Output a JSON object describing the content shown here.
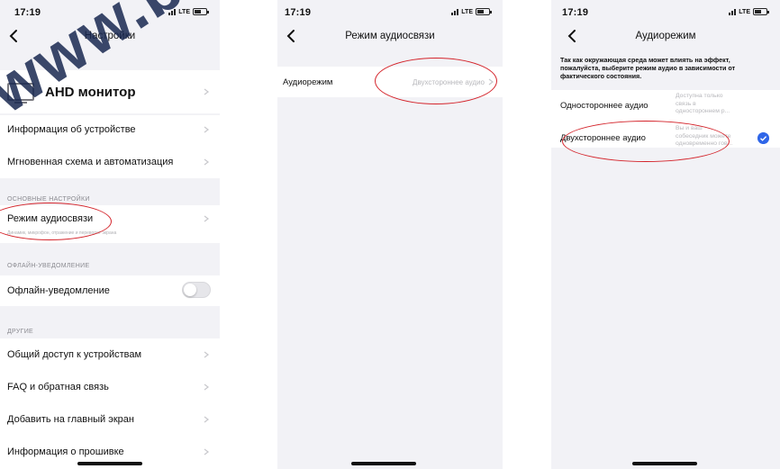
{
  "status_bar": {
    "time": "17:19",
    "network": "LTE"
  },
  "screen1": {
    "title": "Настройки",
    "device_name": "AHD монитор",
    "items": [
      "Информация об устройстве",
      "Мгновенная схема и автоматизация"
    ],
    "section_basic": "ОСНОВНЫЕ НАСТРОЙКИ",
    "audio_mode_label": "Режим аудиосвязи",
    "audio_mode_sub": "Динамик, микрофон, отражение и переворот экрана",
    "section_offline": "ОФЛАЙН-УВЕДОМЛЕНИЕ",
    "offline_label": "Офлайн-уведомление",
    "offline_enabled": false,
    "section_other": "ДРУГИЕ",
    "other_items": [
      "Общий доступ к устройствам",
      "FAQ и обратная связь",
      "Добавить на главный экран",
      "Информация о прошивке"
    ]
  },
  "screen2": {
    "title": "Режим аудиосвязи",
    "row_label": "Аудиорежим",
    "row_value": "Двухстороннее аудио"
  },
  "screen3": {
    "title": "Аудиорежим",
    "description": "Так как окружающая среда может влиять на эффект, пожалуйста, выберите режим аудио в зависимости от фактического состояния.",
    "options": [
      {
        "label": "Одностороннее аудио",
        "desc": [
          "Доступна только",
          "связь в",
          "одностороннем р..."
        ],
        "selected": false
      },
      {
        "label": "Двухстороннее аудио",
        "desc": [
          "Вы и ваш",
          "собеседник можете",
          "одновременно гов..."
        ],
        "selected": true
      }
    ]
  },
  "watermark": "www.bez",
  "colors": {
    "accent": "#2f66e8",
    "highlight_oval": "#d4242b",
    "background": "#f2f2f6"
  }
}
